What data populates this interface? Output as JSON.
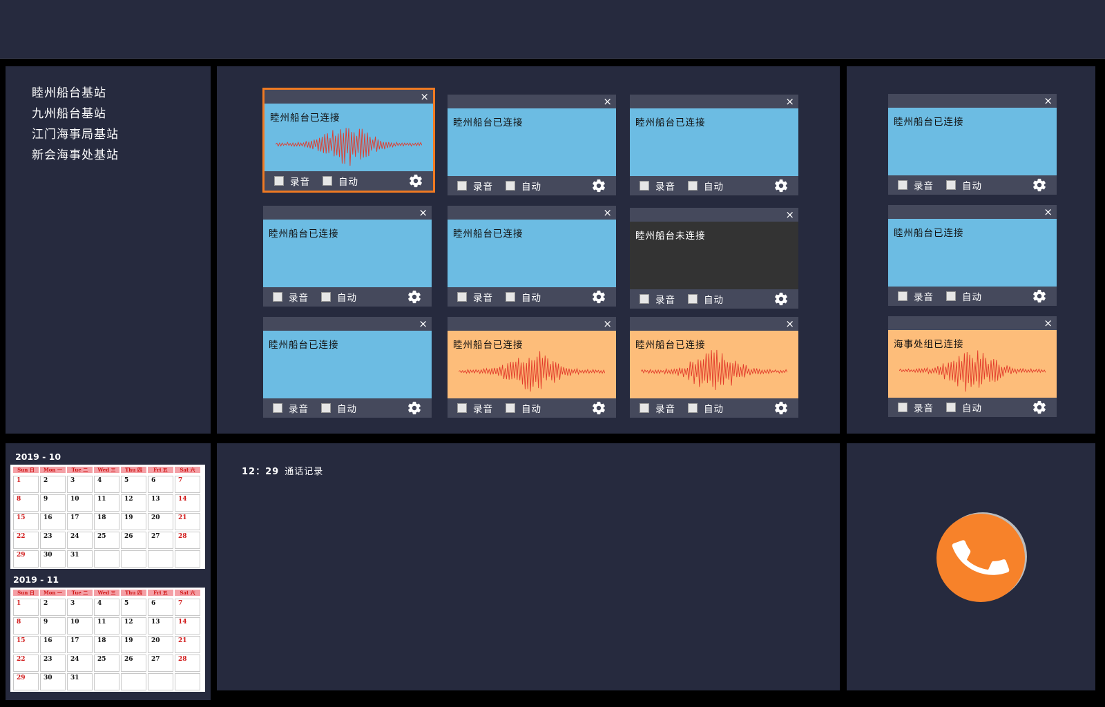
{
  "stations": [
    "睦州船台基站",
    "九州船台基站",
    "江门海事局基站",
    "新会海事处基站"
  ],
  "card_labels": {
    "record": "录音",
    "auto": "自动",
    "close": "×"
  },
  "cards": [
    {
      "status": "睦州船台已连接",
      "state": "blue",
      "wave": true,
      "selected": true
    },
    {
      "status": "睦州船台已连接",
      "state": "blue",
      "wave": false
    },
    {
      "status": "睦州船台已连接",
      "state": "blue",
      "wave": false
    },
    {
      "status": "睦州船台已连接",
      "state": "blue",
      "wave": false
    },
    {
      "status": "睦州船台已连接",
      "state": "blue",
      "wave": false
    },
    {
      "status": "睦州船台未连接",
      "state": "dark",
      "wave": false
    },
    {
      "status": "睦州船台已连接",
      "state": "blue",
      "wave": false
    },
    {
      "status": "睦州船台已连接",
      "state": "orange",
      "wave": true
    },
    {
      "status": "睦州船台已连接",
      "state": "orange",
      "wave": true
    },
    {
      "status": "睦州船台已连接",
      "state": "blue",
      "wave": false
    },
    {
      "status": "睦州船台已连接",
      "state": "blue",
      "wave": false
    },
    {
      "status": "海事处组已连接",
      "state": "orange",
      "wave": true
    }
  ],
  "calendar": {
    "weekdays": [
      "Sun 日",
      "Mon 一",
      "Tue 二",
      "Wed 三",
      "Thu 四",
      "Fri 五",
      "Sat 六"
    ],
    "months": [
      {
        "title": "2019 - 10",
        "days": [
          1,
          2,
          3,
          4,
          5,
          6,
          7,
          8,
          9,
          10,
          11,
          12,
          13,
          14,
          15,
          16,
          17,
          18,
          19,
          20,
          21,
          22,
          23,
          24,
          25,
          26,
          27,
          28,
          29,
          30,
          31
        ]
      },
      {
        "title": "2019 - 11",
        "days": [
          1,
          2,
          3,
          4,
          5,
          6,
          7,
          8,
          9,
          10,
          11,
          12,
          13,
          14,
          15,
          16,
          17,
          18,
          19,
          20,
          21,
          22,
          23,
          24,
          25,
          26,
          27,
          28,
          29,
          30,
          31
        ]
      }
    ]
  },
  "call_log": {
    "time": "12：29",
    "title": "通话记录"
  },
  "colors": {
    "accent": "#f7822a",
    "connected": "#6cbce3",
    "active": "#fdbd7a",
    "disconnected": "#333333",
    "panel": "#262a3e"
  },
  "call_button": {
    "icon": "phone-icon"
  }
}
